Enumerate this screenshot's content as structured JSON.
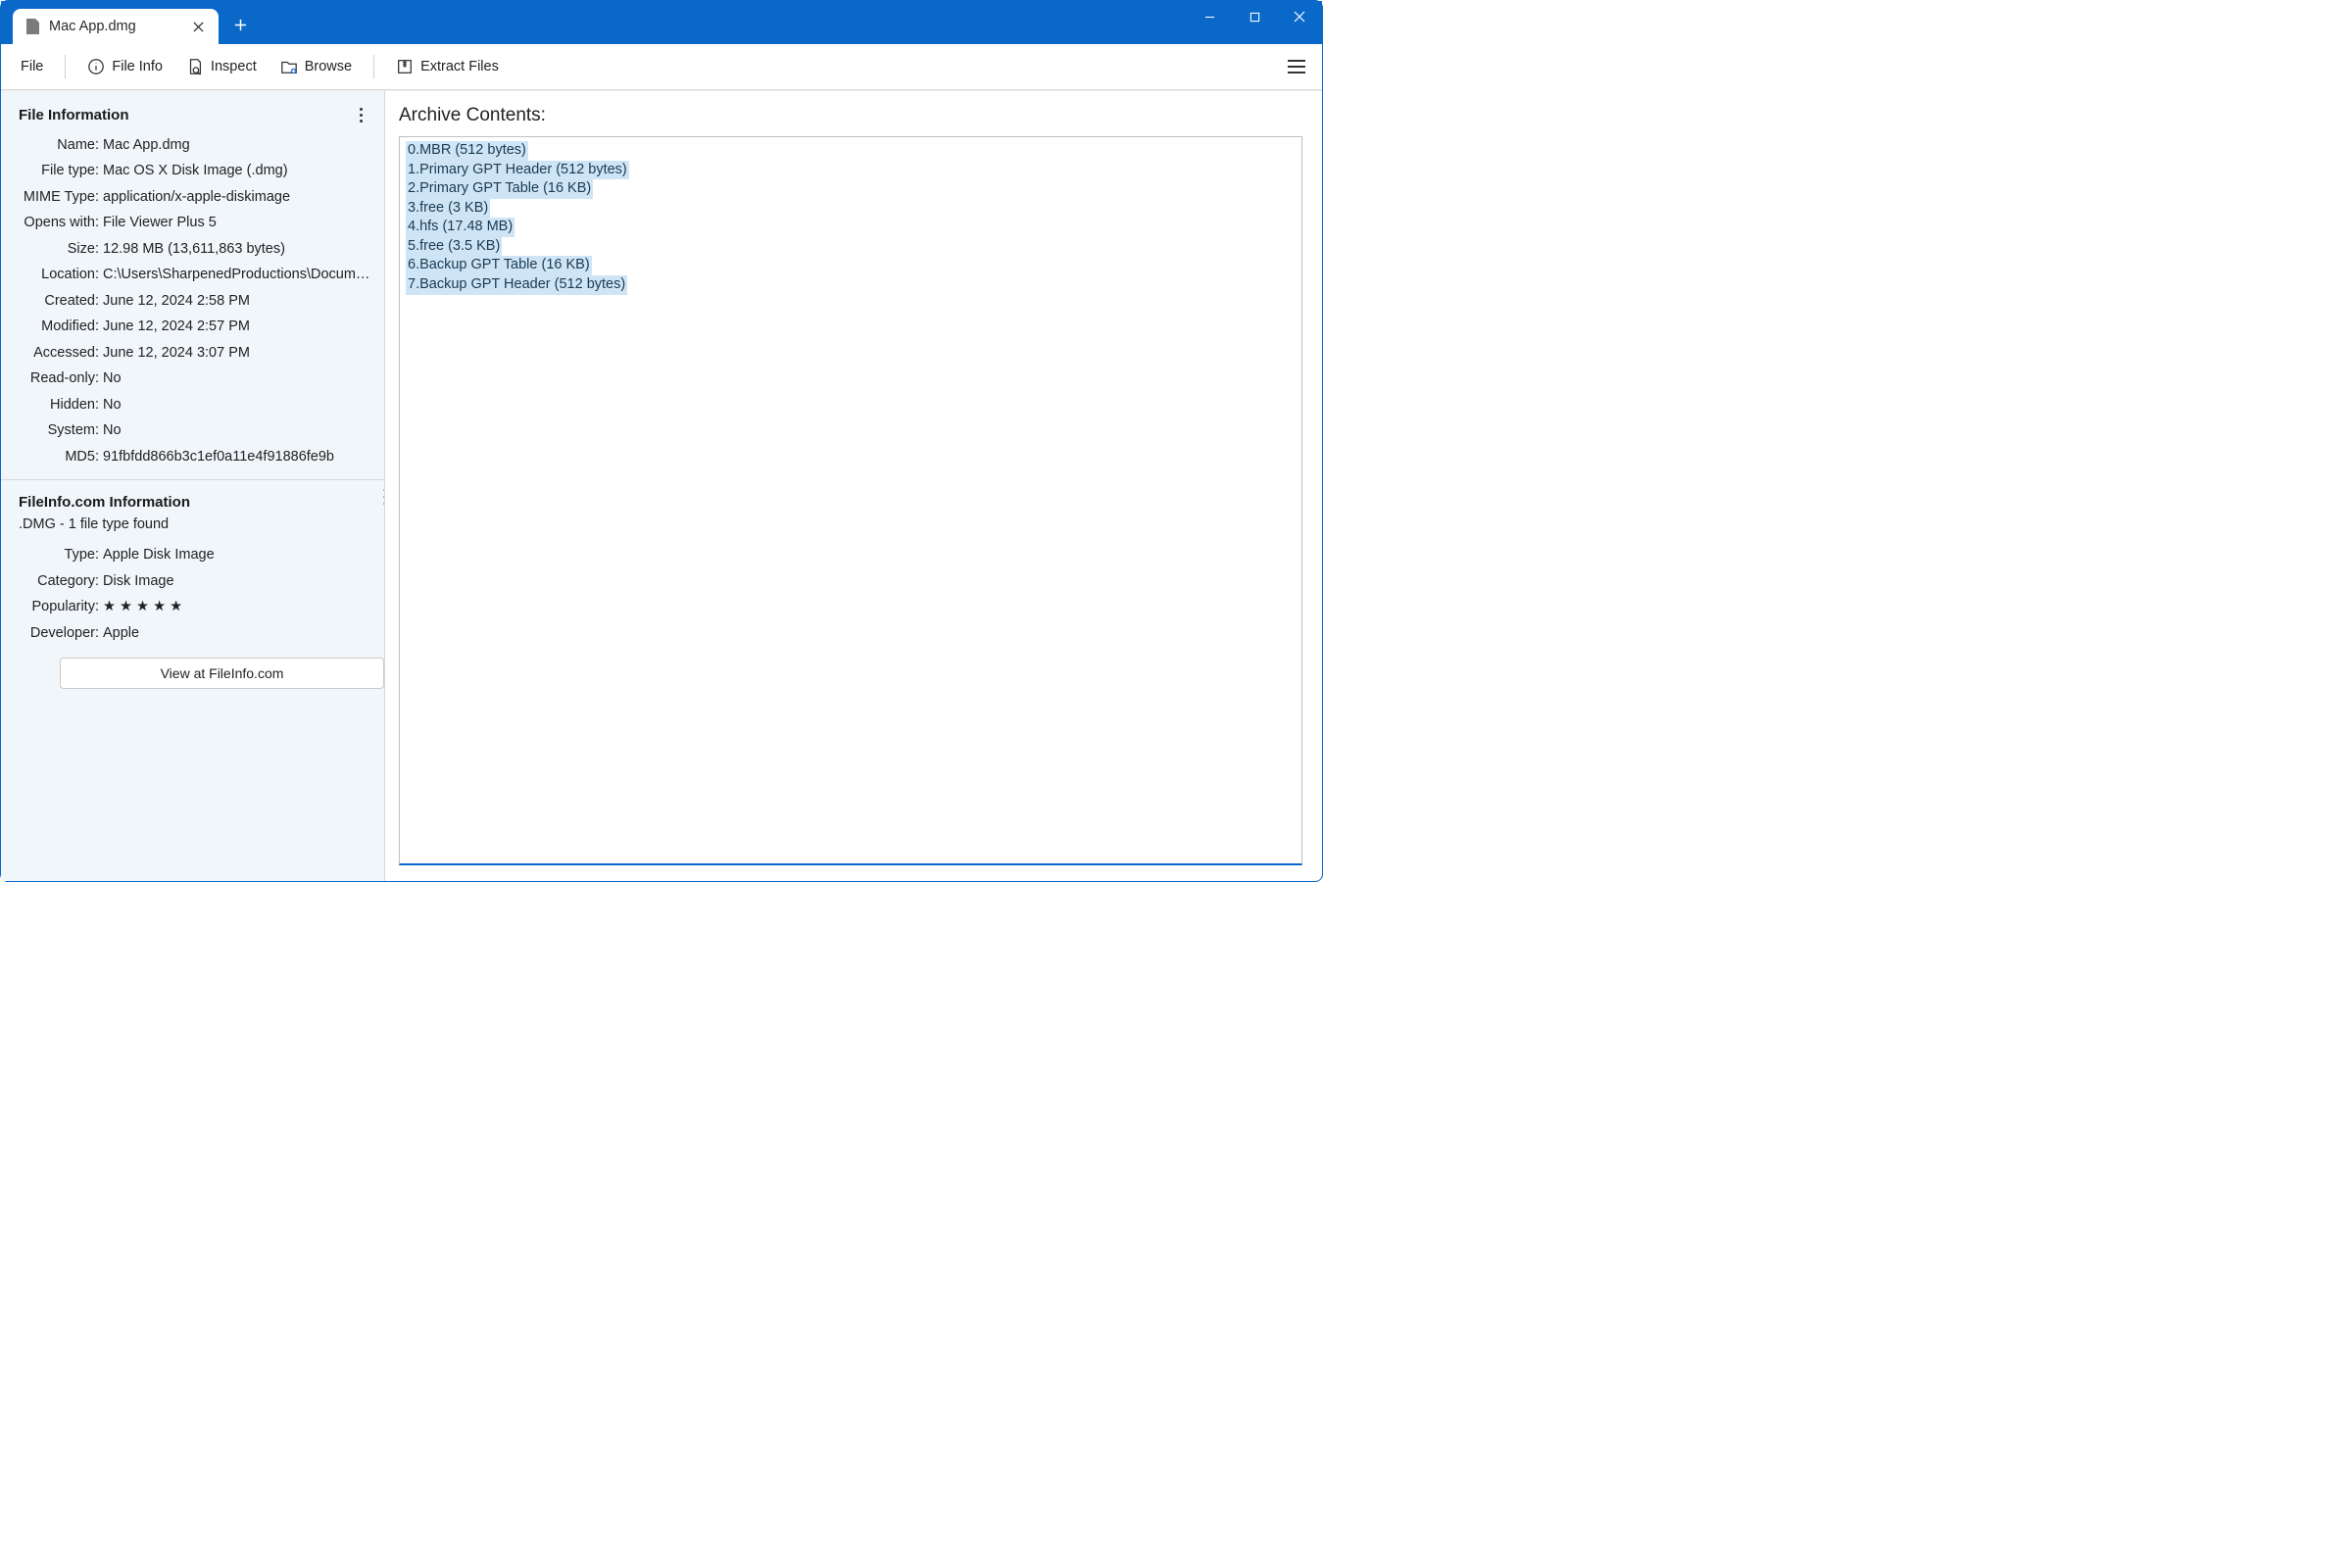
{
  "tab": {
    "title": "Mac App.dmg"
  },
  "toolbar": {
    "file": "File",
    "file_info": "File Info",
    "inspect": "Inspect",
    "browse": "Browse",
    "extract": "Extract Files"
  },
  "file_info": {
    "heading": "File Information",
    "labels": {
      "name": "Name:",
      "file_type": "File type:",
      "mime": "MIME Type:",
      "opens_with": "Opens with:",
      "size": "Size:",
      "location": "Location:",
      "created": "Created:",
      "modified": "Modified:",
      "accessed": "Accessed:",
      "read_only": "Read-only:",
      "hidden": "Hidden:",
      "system": "System:",
      "md5": "MD5:"
    },
    "values": {
      "name": "Mac App.dmg",
      "file_type": "Mac OS X Disk Image (.dmg)",
      "mime": "application/x-apple-diskimage",
      "opens_with": "File Viewer Plus 5",
      "size": "12.98 MB (13,611,863 bytes)",
      "location": "C:\\Users\\SharpenedProductions\\Documents\\...",
      "created": "June 12, 2024 2:58 PM",
      "modified": "June 12, 2024 2:57 PM",
      "accessed": "June 12, 2024 3:07 PM",
      "read_only": "No",
      "hidden": "No",
      "system": "No",
      "md5": "91fbfdd866b3c1ef0a11e4f91886fe9b"
    }
  },
  "fileinfo_com": {
    "heading": "FileInfo.com Information",
    "summary": ".DMG - 1 file type found",
    "labels": {
      "type": "Type:",
      "category": "Category:",
      "popularity": "Popularity:",
      "developer": "Developer:"
    },
    "values": {
      "type": "Apple Disk Image",
      "category": "Disk Image",
      "popularity": "★ ★ ★ ★ ★",
      "developer": "Apple"
    },
    "button": "View at FileInfo.com"
  },
  "content": {
    "heading": "Archive Contents:",
    "entries": [
      "0.MBR (512 bytes)",
      "1.Primary GPT Header (512 bytes)",
      "2.Primary GPT Table (16 KB)",
      "3.free (3 KB)",
      "4.hfs (17.48 MB)",
      "5.free (3.5 KB)",
      "6.Backup GPT Table (16 KB)",
      "7.Backup GPT Header (512 bytes)"
    ]
  }
}
